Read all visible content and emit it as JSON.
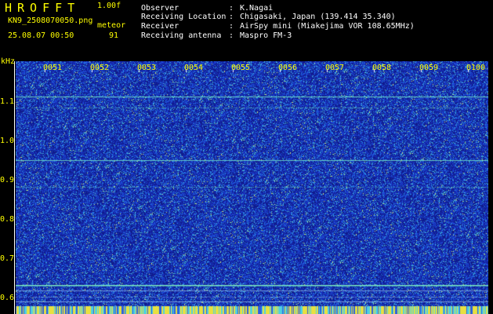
{
  "header": {
    "app_title": "HROFFT",
    "version": "1.00f",
    "file_name": "KN9_2508070050.png",
    "method": "meteor",
    "datetime": "25.08.07 00:50",
    "count": "91"
  },
  "info": [
    {
      "key": "Observer",
      "value": "K.Nagai"
    },
    {
      "key": "Receiving Location",
      "value": "Chigasaki, Japan (139.414 35.340)"
    },
    {
      "key": "Receiver",
      "value": "AirSpy mini (Miakejima VOR 108.65MHz)"
    },
    {
      "key": "Receiving antenna",
      "value": "Maspro FM-3"
    }
  ],
  "axis": {
    "unit": "kHz",
    "y_ticks": [
      "1.1",
      "1.0",
      "0.9",
      "0.8",
      "0.7",
      "0.6"
    ],
    "x_ticks": [
      "0051",
      "0052",
      "0053",
      "0054",
      "0055",
      "0056",
      "0057",
      "0058",
      "0059",
      "0100"
    ]
  },
  "colors": {
    "background": "#000000",
    "label": "#ffff00",
    "text": "#ffffff",
    "noise_base": "#1a2fa8",
    "signal_line": "#4fd6c6"
  }
}
